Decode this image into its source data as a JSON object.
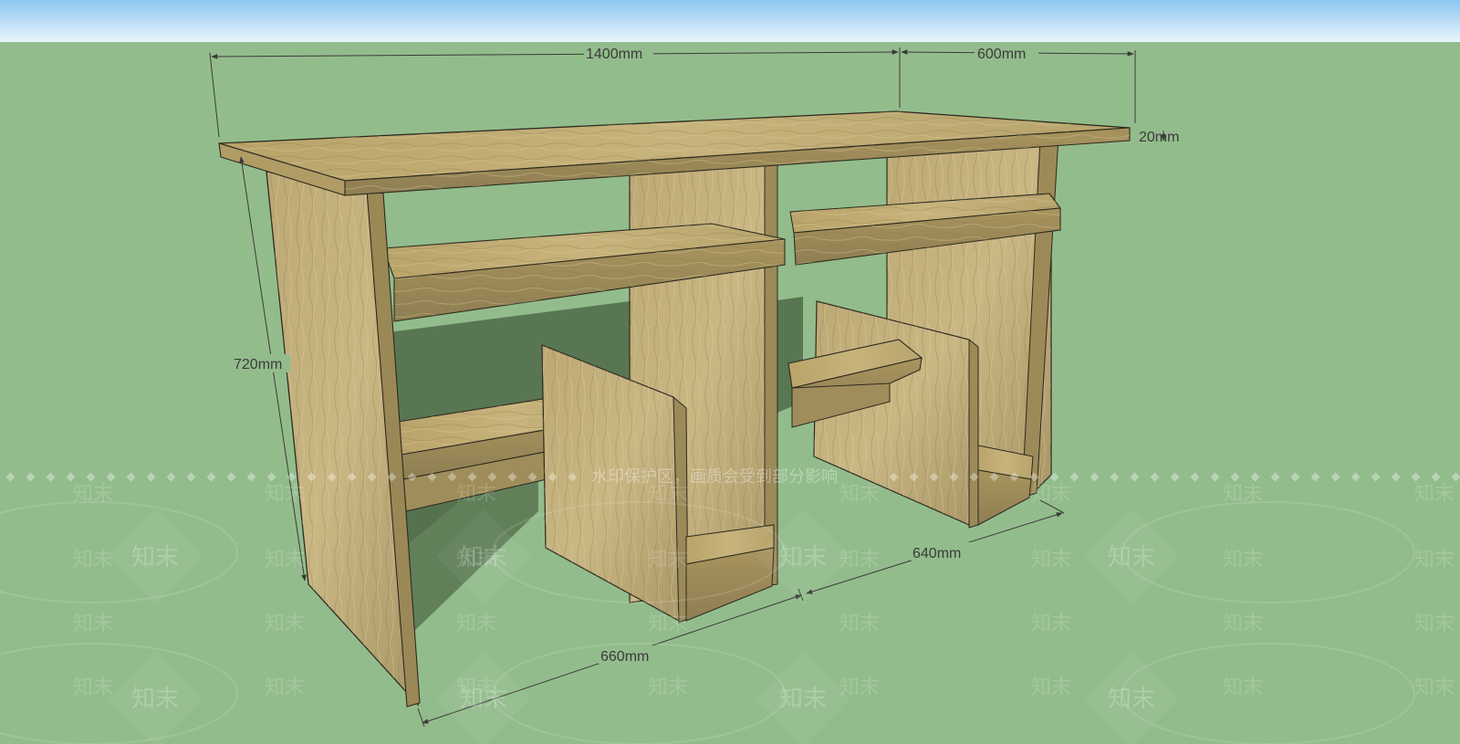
{
  "title": "",
  "dimensions": {
    "width_top": "1400mm",
    "depth_top": "600mm",
    "thickness_top": "20mm",
    "height": "720mm",
    "bay_right": "640mm",
    "bay_left": "660mm"
  },
  "watermark": {
    "brand": "知末",
    "banner": "水印保护区，画质会受到部分影响"
  },
  "colors": {
    "sky_top": "#8cc6f0",
    "sky_bottom": "#e9f5fc",
    "ground": "#93bc8c",
    "wood_light": "#c9b47a",
    "wood_mid": "#ad9a63",
    "wood_dark": "#8a7a4c",
    "edge": "#2c2a20",
    "dim_line": "#3a3a3a",
    "shadow": "#4f6a48"
  }
}
